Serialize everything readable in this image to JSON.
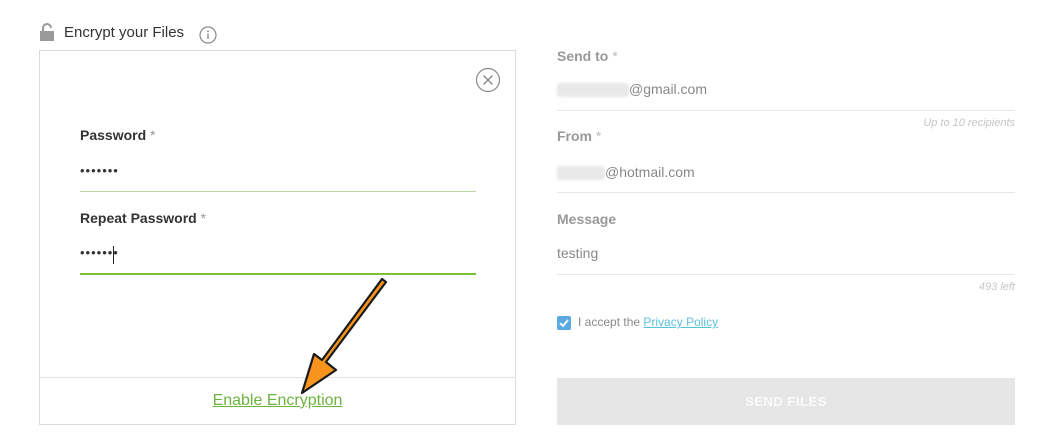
{
  "encrypt": {
    "title": "Encrypt your Files",
    "icons": {
      "lock": "lock-icon",
      "info": "info-icon",
      "close": "close-icon"
    },
    "password_label": "Password",
    "password_value": "•••••••",
    "repeat_label": "Repeat Password",
    "repeat_value": "•••••••",
    "required_mark": "*",
    "enable_label": "Enable Encryption",
    "accent_color": "#6db33f"
  },
  "form": {
    "send_to_label": "Send to",
    "send_to_value": "@gmail.com",
    "recipients_hint": "Up to 10 recipients",
    "from_label": "From",
    "from_value": "@hotmail.com",
    "message_label": "Message",
    "message_value": "testing",
    "chars_left": "493 left",
    "accept_text": "I accept the",
    "privacy_link": "Privacy Policy",
    "accept_checked": true,
    "send_button": "SEND FILES",
    "link_color": "#5bc0de"
  }
}
